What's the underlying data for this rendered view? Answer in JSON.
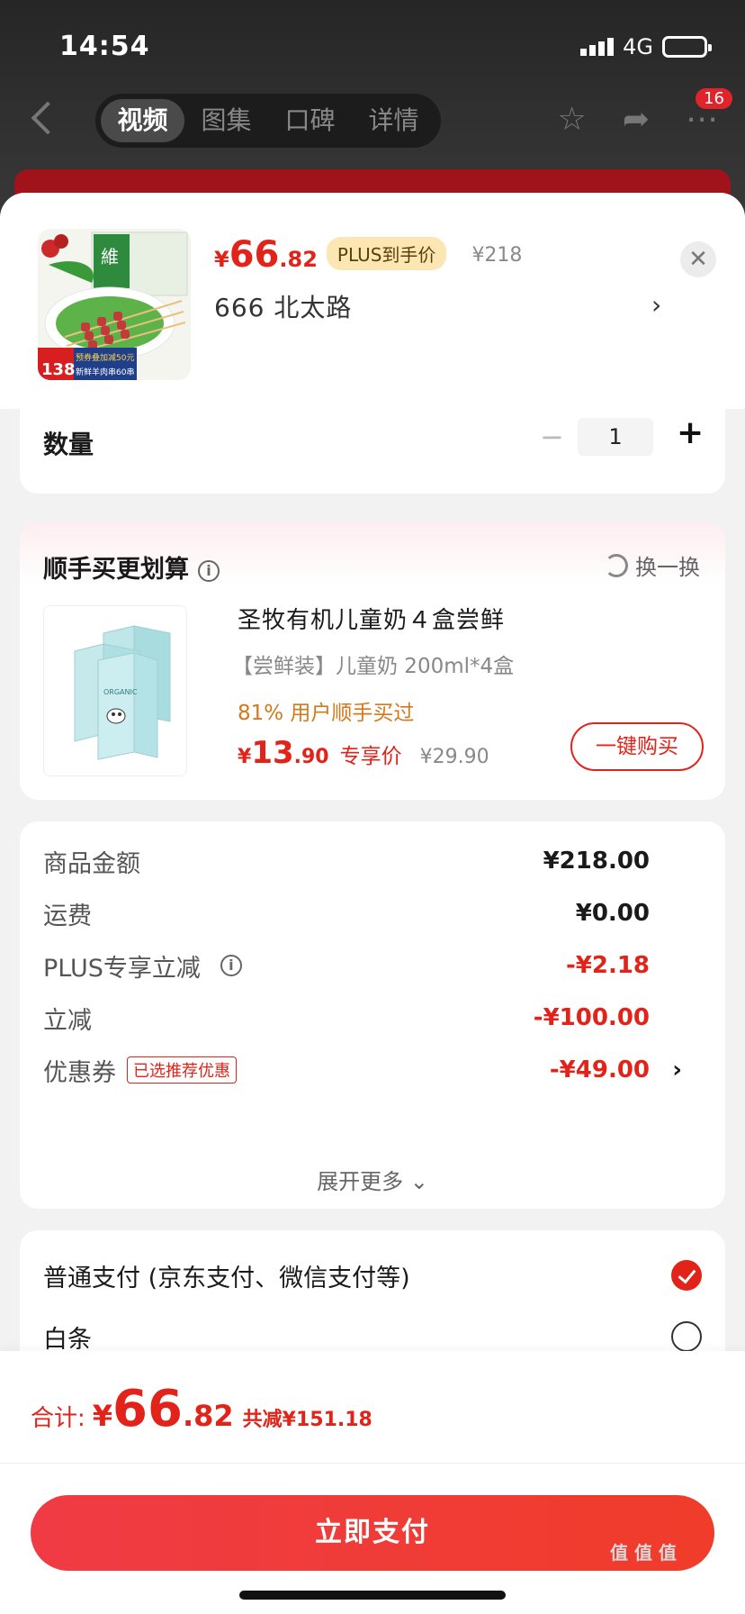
{
  "status_bar": {
    "time": "14:54",
    "network": "4G",
    "icons": [
      "signal-icon",
      "battery-icon"
    ]
  },
  "nav": {
    "tabs": [
      {
        "label": "视频",
        "active": true
      },
      {
        "label": "图集",
        "active": false
      },
      {
        "label": "口碑",
        "active": false
      },
      {
        "label": "详情",
        "active": false
      }
    ],
    "icons": [
      "back-icon",
      "star-icon",
      "share-icon",
      "more-icon"
    ],
    "badge": "16"
  },
  "header": {
    "price_symbol": "¥",
    "price_int": "66",
    "price_dec": ".82",
    "plus_tag": "PLUS到手价",
    "orig_price": "¥218",
    "address": "666  北太路",
    "thumb_badge_price": "138",
    "thumb_banner_1": "新鲜羊肉串60串",
    "thumb_banner_2": "预券叠加减50元",
    "thumb_brand": "維"
  },
  "quantity": {
    "label": "数量",
    "value": "1",
    "minus": "−",
    "plus": "+"
  },
  "upsell": {
    "title": "顺手买更划算",
    "info": "i",
    "swap_label": "换一换",
    "name": "圣牧有机儿童奶４盒尝鲜",
    "spec": "【尝鲜装】儿童奶 200ml*4盒",
    "buyers": "81% 用户顺手买过",
    "price_symbol": "¥",
    "price_int": "13",
    "price_dec": ".90",
    "exclusive": "专享价",
    "orig_price": "¥29.90",
    "buy_button": "一键购买",
    "box_label": "ORGANIC"
  },
  "summary": {
    "rows": [
      {
        "label": "商品金额",
        "value": "¥218.00",
        "red": false
      },
      {
        "label": "运费",
        "value": "¥0.00",
        "red": false
      },
      {
        "label": "PLUS专享立减",
        "value": "-¥2.18",
        "red": true
      },
      {
        "label": "立减",
        "value": "-¥100.00",
        "red": true
      },
      {
        "label": "优惠券",
        "value": "-¥49.00",
        "red": true
      }
    ],
    "coupon_tag": "已选推荐优惠",
    "expand_more": "展开更多 ⌄"
  },
  "payment": {
    "options": [
      {
        "label": "普通支付 (京东支付、微信支付等)",
        "checked": true
      },
      {
        "label": "白条",
        "checked": false
      }
    ]
  },
  "footer": {
    "total_label": "合计:",
    "price_symbol": "¥",
    "price_int": "66",
    "price_dec": ".82",
    "total_save": "共减¥151.18",
    "pay_button": "立即支付"
  },
  "watermark": "值 值 值",
  "colors": {
    "accent": "#e2231a",
    "plus_gold": "#fbe6b4",
    "buyers_orange": "#d4781c"
  }
}
